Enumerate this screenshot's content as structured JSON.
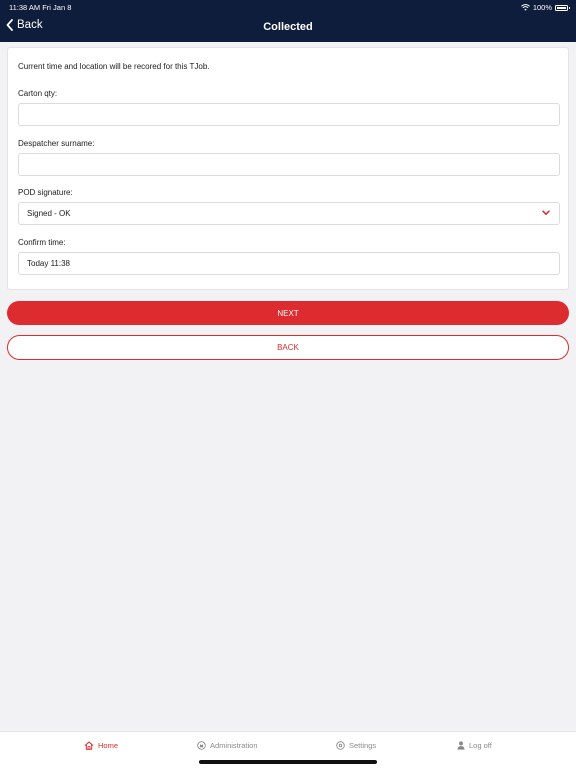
{
  "status_bar": {
    "time": "11:38 AM   Fri Jan 8",
    "battery": "100%"
  },
  "nav": {
    "back_label": "Back",
    "title": "Collected"
  },
  "form": {
    "intro": "Current time and location will be recored for this TJob.",
    "carton_qty": {
      "label": "Carton qty:",
      "value": ""
    },
    "despatcher_surname": {
      "label": "Despatcher surname:",
      "value": ""
    },
    "pod_signature": {
      "label": "POD signature:",
      "value": "Signed - OK"
    },
    "confirm_time": {
      "label": "Confirm time:",
      "value": "Today 11:38"
    }
  },
  "actions": {
    "next_label": "NEXT",
    "back_label": "BACK"
  },
  "tabs": [
    {
      "label": "Home",
      "icon": "home-icon",
      "active": true
    },
    {
      "label": "Administration",
      "icon": "admin-icon",
      "active": false
    },
    {
      "label": "Settings",
      "icon": "settings-icon",
      "active": false
    },
    {
      "label": "Log off",
      "icon": "user-icon",
      "active": false
    }
  ],
  "colors": {
    "nav_bg": "#0f1d3c",
    "accent": "#dc2c2f",
    "background": "#f2f2f4"
  }
}
